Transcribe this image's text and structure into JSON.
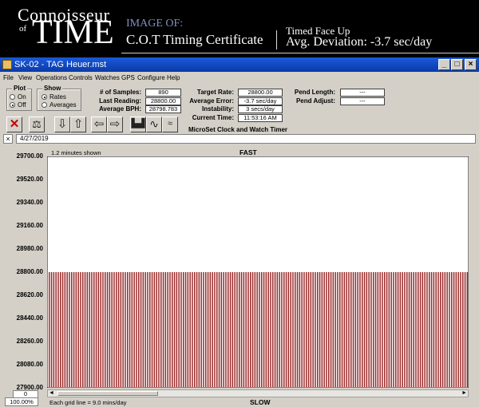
{
  "banner": {
    "logo_top": "Connoisseur",
    "logo_of": "of",
    "logo_time": "TIME",
    "image_of": "IMAGE OF:",
    "certificate_title": "C.O.T Timing Certificate",
    "position": "Timed Face Up",
    "avg_deviation": "Avg. Deviation: -3.7 sec/day"
  },
  "window": {
    "title": "SK-02 - TAG Heuer.mst",
    "controls": [
      "_",
      "□",
      "×"
    ]
  },
  "menu": [
    "File",
    "View",
    "Operations",
    "Controls",
    "Watches",
    "GPS",
    "Configure",
    "Help"
  ],
  "plot_group": {
    "label": "Plot",
    "options": [
      "On",
      "Off"
    ],
    "selected": "Off"
  },
  "show_group": {
    "label": "Show",
    "options": [
      "Rates",
      "Averages"
    ],
    "selected": "Rates"
  },
  "fields": {
    "samples": {
      "label": "# of Samples:",
      "value": "890"
    },
    "last_reading": {
      "label": "Last Reading:",
      "value": "28800.00"
    },
    "average_bph": {
      "label": "Average BPH:",
      "value": "28798.783"
    },
    "target_rate": {
      "label": "Target Rate:",
      "value": "28800.00"
    },
    "average_error": {
      "label": "Average Error:",
      "value": "-3.7 sec/day"
    },
    "instability": {
      "label": "Instability:",
      "value": "3 secs/day"
    },
    "current_time": {
      "label": "Current Time:",
      "value": "11:53:16 AM"
    },
    "pend_length": {
      "label": "Pend Length:",
      "value": "---"
    },
    "pend_adjust": {
      "label": "Pend Adjust:",
      "value": "---"
    }
  },
  "toolbar": {
    "icons": [
      "close-x-icon",
      "balance-scale-icon",
      "arrow-down-icon",
      "arrow-up-icon",
      "arrow-left-icon",
      "arrow-right-icon",
      "bar-chart-icon",
      "sine-wave-icon",
      "wavy-lines-icon"
    ],
    "brand": "MicroSet Clock and Watch Timer"
  },
  "date": {
    "value": "4/27/2019",
    "clear": "×"
  },
  "graph": {
    "shown": "1.2 minutes shown",
    "fast_label": "FAST",
    "slow_label": "SLOW",
    "grid_note": "Each grid line = 9.0 mins/day",
    "zoom": "100.00%",
    "counter": "0"
  },
  "chart_data": {
    "type": "bar",
    "y_ticks": [
      "29700.00",
      "29520.00",
      "29340.00",
      "29160.00",
      "28980.00",
      "28800.00",
      "28620.00",
      "28440.00",
      "28260.00",
      "28080.00",
      "27900.00"
    ],
    "ylim": [
      27900,
      29700
    ],
    "bar_value": 28800.0,
    "bar_color": "#9a2a2a",
    "background": "#ffffff",
    "grid": false
  }
}
